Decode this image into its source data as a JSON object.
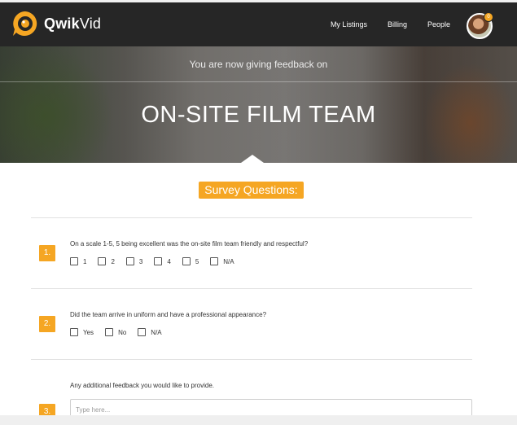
{
  "app": {
    "name_bold": "Qwik",
    "name_regular": "Vid",
    "brand_color": "#f5a623"
  },
  "nav": {
    "links": [
      "My Listings",
      "Billing",
      "People"
    ],
    "notification_count": "0"
  },
  "hero": {
    "subtitle": "You are now giving feedback on",
    "title": "ON-SITE FILM TEAM"
  },
  "survey": {
    "heading": "Survey Questions:",
    "questions": [
      {
        "number": "1.",
        "text": "On a scale 1-5, 5 being excellent was the on-site film team friendly and respectful?",
        "options": [
          "1",
          "2",
          "3",
          "4",
          "5",
          "N/A"
        ]
      },
      {
        "number": "2.",
        "text": "Did the team arrive in uniform and have a professional appearance?",
        "options": [
          "Yes",
          "No",
          "N/A"
        ]
      },
      {
        "number": "3.",
        "text": "Any additional feedback you would like to provide.",
        "placeholder": "Type here..."
      }
    ]
  }
}
